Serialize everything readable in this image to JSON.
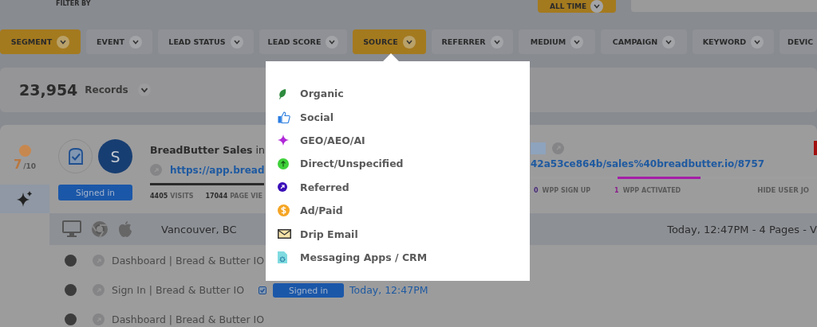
{
  "filter_label": "FILTER BY",
  "date_range": {
    "label": "ALL TIME"
  },
  "filters": [
    {
      "label": "SEGMENT",
      "selected": true
    },
    {
      "label": "EVENT",
      "selected": false
    },
    {
      "label": "LEAD STATUS",
      "selected": false
    },
    {
      "label": "LEAD SCORE",
      "selected": false
    },
    {
      "label": "SOURCE",
      "selected": true
    },
    {
      "label": "REFERRER",
      "selected": false
    },
    {
      "label": "MEDIUM",
      "selected": false
    },
    {
      "label": "CAMPAIGN",
      "selected": false
    },
    {
      "label": "KEYWORD",
      "selected": false
    },
    {
      "label": "DEVIC",
      "selected": false
    }
  ],
  "records": {
    "count": "23,954",
    "label": "Records"
  },
  "visitor": {
    "score": "7",
    "score_max": "/10",
    "initial": "S",
    "status": "Signed in",
    "name": "BreadButter Sales",
    "name_suffix": "in",
    "url_start": "https://app.bread",
    "url_end": "42a53ce864b/sales%40breadbutter.io/8757",
    "stats_left": [
      {
        "value": "4405",
        "label": "VISITS"
      },
      {
        "value": "17044",
        "label": "PAGE VIE"
      }
    ],
    "stats_right": [
      {
        "value": "0",
        "label": "WPP SIGN UP",
        "color": "#4a2a7a"
      },
      {
        "value": "1",
        "label": "WPP ACTIVATED",
        "color": "#8a1f8a"
      }
    ],
    "hide_label": "HIDE USER JO",
    "location": "Vancouver, BC",
    "visit_summary": "Today, 12:47PM - 4 Pages - V"
  },
  "pages": [
    {
      "title": "Dashboard | Bread & Butter IO"
    },
    {
      "title": "Sign In | Bread & Butter IO",
      "status": "Signed in",
      "time": "Today, 12:47PM"
    },
    {
      "title": "Dashboard | Bread & Butter IO"
    }
  ],
  "source_menu": {
    "items": [
      {
        "label": "Organic",
        "kind": "organic"
      },
      {
        "label": "Social",
        "kind": "social"
      },
      {
        "label": "GEO/AEO/AI",
        "kind": "ai"
      },
      {
        "label": "Direct/Unspecified",
        "kind": "direct"
      },
      {
        "label": "Referred",
        "kind": "referred"
      },
      {
        "label": "Ad/Paid",
        "kind": "paid"
      },
      {
        "label": "Drip Email",
        "kind": "email"
      },
      {
        "label": "Messaging Apps / CRM",
        "kind": "messaging"
      }
    ]
  }
}
